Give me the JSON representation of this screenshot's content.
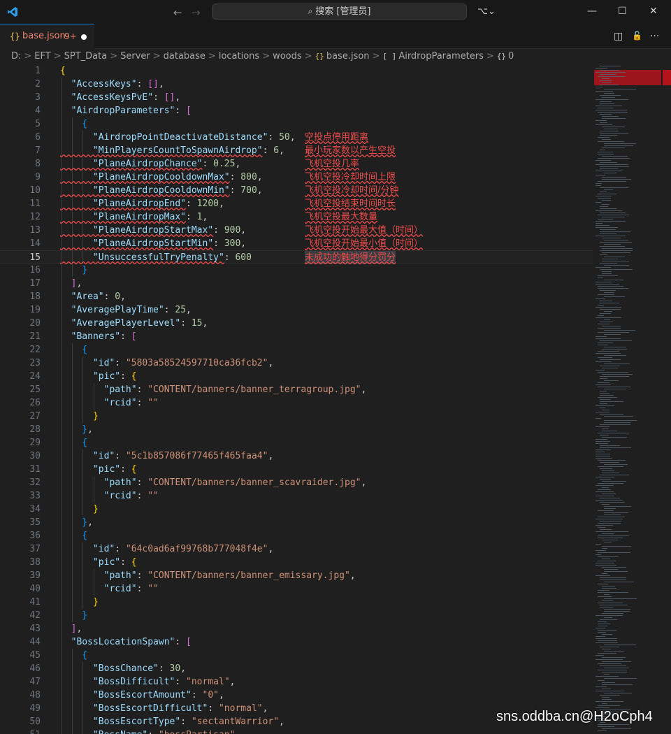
{
  "window": {
    "search_text": "搜索 [管理员]",
    "nav_back": "←",
    "nav_forward": "→",
    "copilot_label": "⌥⌄",
    "minimize": "—",
    "maximize": "☐",
    "close": "✕"
  },
  "tab": {
    "icon": "{}",
    "name": "base.json",
    "problems": "9+"
  },
  "tab_actions": {
    "split": "◫",
    "lock": "🔓",
    "more": "···"
  },
  "breadcrumb": {
    "items": [
      "D:",
      "EFT",
      "SPT_Data",
      "Server",
      "database",
      "locations",
      "woods",
      "base.json",
      "AirdropParameters",
      "0"
    ],
    "json_icon": "{}",
    "array_icon": "[ ]",
    "object_icon": "{}"
  },
  "editor": {
    "current_line": 15,
    "lines": [
      {
        "n": "1",
        "t": [
          [
            "b1",
            "{"
          ]
        ]
      },
      {
        "n": "2",
        "t": [
          [
            "k",
            "  \"AccessKeys\""
          ],
          [
            "p",
            ": "
          ],
          [
            "b2",
            "[]"
          ],
          [
            "p",
            ","
          ]
        ]
      },
      {
        "n": "3",
        "t": [
          [
            "k",
            "  \"AccessKeysPvE\""
          ],
          [
            "p",
            ": "
          ],
          [
            "b2",
            "[]"
          ],
          [
            "p",
            ","
          ]
        ]
      },
      {
        "n": "4",
        "t": [
          [
            "k",
            "  \"AirdropParameters\""
          ],
          [
            "p",
            ": "
          ],
          [
            "b2",
            "["
          ]
        ]
      },
      {
        "n": "5",
        "t": [
          [
            "b3",
            "    {"
          ]
        ]
      },
      {
        "n": "6",
        "t": [
          [
            "k",
            "      \"AirdropPointDeactivateDistance\""
          ],
          [
            "p",
            ": "
          ],
          [
            "n",
            "50"
          ],
          [
            "p",
            ","
          ]
        ],
        "c": "空投点停用距离"
      },
      {
        "n": "7",
        "t": [
          [
            "k err",
            "      \"MinPlayersCountToSpawnAirdrop\""
          ],
          [
            "p",
            ": "
          ],
          [
            "n",
            "6"
          ],
          [
            "p",
            ","
          ]
        ],
        "c": "最小玩家数以产生空投"
      },
      {
        "n": "8",
        "t": [
          [
            "k err",
            "      \"PlaneAirdropChance\""
          ],
          [
            "p",
            ": "
          ],
          [
            "n",
            "0.25"
          ],
          [
            "p",
            ","
          ]
        ],
        "c": "飞机空投几率"
      },
      {
        "n": "9",
        "t": [
          [
            "k err",
            "      \"PlaneAirdropCooldownMax\""
          ],
          [
            "p",
            ": "
          ],
          [
            "n",
            "800"
          ],
          [
            "p",
            ","
          ]
        ],
        "c": "飞机空投冷却时间上限"
      },
      {
        "n": "10",
        "t": [
          [
            "k err",
            "      \"PlaneAirdropCooldownMin\""
          ],
          [
            "p",
            ": "
          ],
          [
            "n",
            "700"
          ],
          [
            "p",
            ","
          ]
        ],
        "c": "飞机空投冷却时间/分钟"
      },
      {
        "n": "11",
        "t": [
          [
            "k err",
            "      \"PlaneAirdropEnd\""
          ],
          [
            "p",
            ": "
          ],
          [
            "n",
            "1200"
          ],
          [
            "p",
            ","
          ]
        ],
        "c": "飞机空投结束时间时长"
      },
      {
        "n": "12",
        "t": [
          [
            "k err",
            "      \"PlaneAirdropMax\""
          ],
          [
            "p",
            ": "
          ],
          [
            "n",
            "1"
          ],
          [
            "p",
            ","
          ]
        ],
        "c": "飞机空投最大数量"
      },
      {
        "n": "13",
        "t": [
          [
            "k err",
            "      \"PlaneAirdropStartMax\""
          ],
          [
            "p",
            ": "
          ],
          [
            "n",
            "900"
          ],
          [
            "p",
            ","
          ]
        ],
        "c": "飞机空投开始最大值（时间）"
      },
      {
        "n": "14",
        "t": [
          [
            "k err",
            "      \"PlaneAirdropStartMin\""
          ],
          [
            "p",
            ": "
          ],
          [
            "n",
            "300"
          ],
          [
            "p",
            ","
          ]
        ],
        "c": "飞机空投开始最小值（时间）"
      },
      {
        "n": "15",
        "t": [
          [
            "k err",
            "      \"UnsuccessfulTryPenalty\""
          ],
          [
            "p",
            ": "
          ],
          [
            "n",
            "600"
          ]
        ],
        "c": "未成功的触地得分罚分"
      },
      {
        "n": "16",
        "t": [
          [
            "b3",
            "    }"
          ]
        ]
      },
      {
        "n": "17",
        "t": [
          [
            "b2",
            "  ]"
          ],
          [
            "p",
            ","
          ]
        ]
      },
      {
        "n": "18",
        "t": [
          [
            "k",
            "  \"Area\""
          ],
          [
            "p",
            ": "
          ],
          [
            "n",
            "0"
          ],
          [
            "p",
            ","
          ]
        ]
      },
      {
        "n": "19",
        "t": [
          [
            "k",
            "  \"AveragePlayTime\""
          ],
          [
            "p",
            ": "
          ],
          [
            "n",
            "25"
          ],
          [
            "p",
            ","
          ]
        ]
      },
      {
        "n": "20",
        "t": [
          [
            "k",
            "  \"AveragePlayerLevel\""
          ],
          [
            "p",
            ": "
          ],
          [
            "n",
            "15"
          ],
          [
            "p",
            ","
          ]
        ]
      },
      {
        "n": "21",
        "t": [
          [
            "k",
            "  \"Banners\""
          ],
          [
            "p",
            ": "
          ],
          [
            "b2",
            "["
          ]
        ]
      },
      {
        "n": "22",
        "t": [
          [
            "b3",
            "    {"
          ]
        ]
      },
      {
        "n": "23",
        "t": [
          [
            "k",
            "      \"id\""
          ],
          [
            "p",
            ": "
          ],
          [
            "s",
            "\"5803a58524597710ca36fcb2\""
          ],
          [
            "p",
            ","
          ]
        ]
      },
      {
        "n": "24",
        "t": [
          [
            "k",
            "      \"pic\""
          ],
          [
            "p",
            ": "
          ],
          [
            "b1",
            "{"
          ]
        ]
      },
      {
        "n": "25",
        "t": [
          [
            "k",
            "        \"path\""
          ],
          [
            "p",
            ": "
          ],
          [
            "s",
            "\"CONTENT/banners/banner_terragroup.jpg\""
          ],
          [
            "p",
            ","
          ]
        ]
      },
      {
        "n": "26",
        "t": [
          [
            "k",
            "        \"rcid\""
          ],
          [
            "p",
            ": "
          ],
          [
            "s",
            "\"\""
          ]
        ]
      },
      {
        "n": "27",
        "t": [
          [
            "b1",
            "      }"
          ]
        ]
      },
      {
        "n": "28",
        "t": [
          [
            "b3",
            "    }"
          ],
          [
            "p",
            ","
          ]
        ]
      },
      {
        "n": "29",
        "t": [
          [
            "b3",
            "    {"
          ]
        ]
      },
      {
        "n": "30",
        "t": [
          [
            "k",
            "      \"id\""
          ],
          [
            "p",
            ": "
          ],
          [
            "s",
            "\"5c1b857086f77465f465faa4\""
          ],
          [
            "p",
            ","
          ]
        ]
      },
      {
        "n": "31",
        "t": [
          [
            "k",
            "      \"pic\""
          ],
          [
            "p",
            ": "
          ],
          [
            "b1",
            "{"
          ]
        ]
      },
      {
        "n": "32",
        "t": [
          [
            "k",
            "        \"path\""
          ],
          [
            "p",
            ": "
          ],
          [
            "s",
            "\"CONTENT/banners/banner_scavraider.jpg\""
          ],
          [
            "p",
            ","
          ]
        ]
      },
      {
        "n": "33",
        "t": [
          [
            "k",
            "        \"rcid\""
          ],
          [
            "p",
            ": "
          ],
          [
            "s",
            "\"\""
          ]
        ]
      },
      {
        "n": "34",
        "t": [
          [
            "b1",
            "      }"
          ]
        ]
      },
      {
        "n": "35",
        "t": [
          [
            "b3",
            "    }"
          ],
          [
            "p",
            ","
          ]
        ]
      },
      {
        "n": "36",
        "t": [
          [
            "b3",
            "    {"
          ]
        ]
      },
      {
        "n": "37",
        "t": [
          [
            "k",
            "      \"id\""
          ],
          [
            "p",
            ": "
          ],
          [
            "s",
            "\"64c0ad6af99768b777048f4e\""
          ],
          [
            "p",
            ","
          ]
        ]
      },
      {
        "n": "38",
        "t": [
          [
            "k",
            "      \"pic\""
          ],
          [
            "p",
            ": "
          ],
          [
            "b1",
            "{"
          ]
        ]
      },
      {
        "n": "39",
        "t": [
          [
            "k",
            "        \"path\""
          ],
          [
            "p",
            ": "
          ],
          [
            "s",
            "\"CONTENT/banners/banner_emissary.jpg\""
          ],
          [
            "p",
            ","
          ]
        ]
      },
      {
        "n": "40",
        "t": [
          [
            "k",
            "        \"rcid\""
          ],
          [
            "p",
            ": "
          ],
          [
            "s",
            "\"\""
          ]
        ]
      },
      {
        "n": "41",
        "t": [
          [
            "b1",
            "      }"
          ]
        ]
      },
      {
        "n": "42",
        "t": [
          [
            "b3",
            "    }"
          ]
        ]
      },
      {
        "n": "43",
        "t": [
          [
            "b2",
            "  ]"
          ],
          [
            "p",
            ","
          ]
        ]
      },
      {
        "n": "44",
        "t": [
          [
            "k",
            "  \"BossLocationSpawn\""
          ],
          [
            "p",
            ": "
          ],
          [
            "b2",
            "["
          ]
        ]
      },
      {
        "n": "45",
        "t": [
          [
            "b3",
            "    {"
          ]
        ]
      },
      {
        "n": "46",
        "t": [
          [
            "k",
            "      \"BossChance\""
          ],
          [
            "p",
            ": "
          ],
          [
            "n",
            "30"
          ],
          [
            "p",
            ","
          ]
        ]
      },
      {
        "n": "47",
        "t": [
          [
            "k",
            "      \"BossDifficult\""
          ],
          [
            "p",
            ": "
          ],
          [
            "s",
            "\"normal\""
          ],
          [
            "p",
            ","
          ]
        ]
      },
      {
        "n": "48",
        "t": [
          [
            "k",
            "      \"BossEscortAmount\""
          ],
          [
            "p",
            ": "
          ],
          [
            "s",
            "\"0\""
          ],
          [
            "p",
            ","
          ]
        ]
      },
      {
        "n": "49",
        "t": [
          [
            "k",
            "      \"BossEscortDifficult\""
          ],
          [
            "p",
            ": "
          ],
          [
            "s",
            "\"normal\""
          ],
          [
            "p",
            ","
          ]
        ]
      },
      {
        "n": "50",
        "t": [
          [
            "k",
            "      \"BossEscortType\""
          ],
          [
            "p",
            ": "
          ],
          [
            "s",
            "\"sectantWarrior\""
          ],
          [
            "p",
            ","
          ]
        ]
      },
      {
        "n": "51",
        "t": [
          [
            "k",
            "      \"BossName\""
          ],
          [
            "p",
            ": "
          ],
          [
            "s",
            "\"bossPartisan\""
          ]
        ]
      }
    ]
  },
  "watermark": "sns.oddba.cn@H2oCph4"
}
